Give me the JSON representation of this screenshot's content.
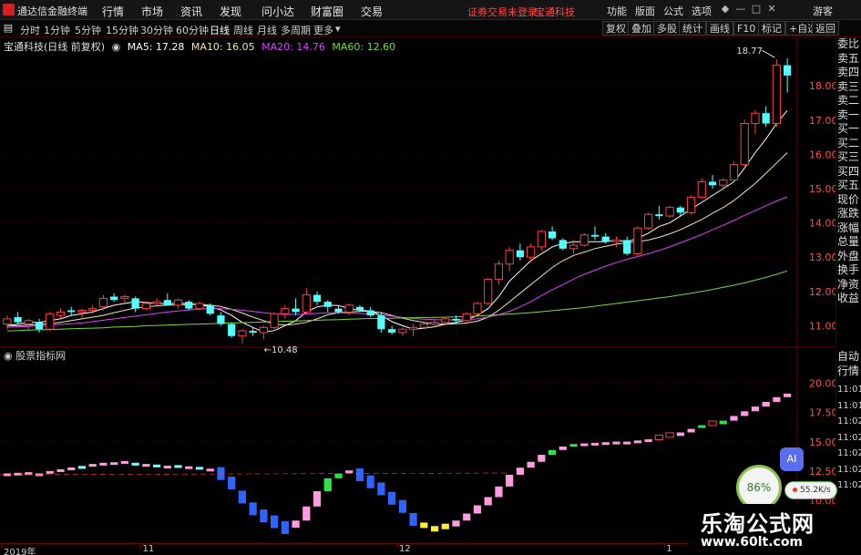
{
  "app": {
    "title": "通达信金融终端"
  },
  "menubar": {
    "items": [
      "行情",
      "市场",
      "资讯",
      "发现",
      "问小达",
      "财富圈",
      "交易"
    ],
    "notice": "证券交易未登录",
    "stock": "宝通科技",
    "right": [
      "功能",
      "版面",
      "公式",
      "选项"
    ],
    "user": "游客"
  },
  "periods": [
    "分时",
    "1分钟",
    "5分钟",
    "15分钟",
    "30分钟",
    "60分钟",
    "日线",
    "周线",
    "月线",
    "多周期",
    "更多"
  ],
  "active_period": "日线",
  "tools": [
    "复权",
    "叠加",
    "多股",
    "统计",
    "画线",
    "F10",
    "标记",
    "+自选",
    "返回"
  ],
  "stock_label": "宝通科技(日线 前复权)",
  "ma": [
    {
      "label": "MA5: 17.28",
      "color": "#ffffff"
    },
    {
      "label": "MA10: 16.05",
      "color": "#f3e5ab"
    },
    {
      "label": "MA20: 14.76",
      "color": "#e040fb"
    },
    {
      "label": "MA60: 12.60",
      "color": "#7cd942"
    }
  ],
  "indicator_label": "股票指标网",
  "order_items": [
    "委比",
    "卖五",
    "卖四",
    "卖三",
    "卖二",
    "卖一",
    "买一",
    "买二",
    "买三",
    "买四",
    "买五",
    "现价",
    "涨跌",
    "涨幅",
    "总量",
    "外盘",
    "换手",
    "净资",
    "收益"
  ],
  "order_items_2": [
    "自动",
    "行情"
  ],
  "time_ticks": [
    "11:01",
    "11:01",
    "11:02",
    "11:02",
    "11:02",
    "11:02",
    "11:02"
  ],
  "ai_button": "AI",
  "speed": {
    "ring": "86%",
    "rate": "55.2K/s"
  },
  "watermark": {
    "title": "乐淘公式网",
    "url": "www.60lt.com"
  },
  "colors": {
    "up": "#ff4040",
    "down": "#54ffff",
    "ma5": "#ffffff",
    "ma10": "#f3e5ab",
    "ma20": "#e040fb",
    "ma60": "#7cd942",
    "grid": "#3a0000"
  },
  "chart_data": [
    {
      "type": "candlestick",
      "series_name": "宝通科技",
      "x_labels": [
        "2019年",
        "11",
        "12",
        "1"
      ],
      "x_label_index": [
        0,
        13,
        37,
        62
      ],
      "ylim": [
        10.4,
        19.2
      ],
      "y_ticks": [
        11.0,
        12.0,
        13.0,
        14.0,
        15.0,
        16.0,
        17.0,
        18.0
      ],
      "annotations": [
        {
          "text": "18.77",
          "index": 72,
          "value": 18.77
        },
        {
          "text": "10.48",
          "index": 23,
          "value": 10.48
        }
      ],
      "ohlc": [
        [
          11.05,
          11.3,
          10.9,
          11.2
        ],
        [
          11.25,
          11.4,
          11.05,
          11.1
        ],
        [
          11.05,
          11.2,
          10.85,
          11.15
        ],
        [
          11.1,
          11.2,
          10.8,
          10.9
        ],
        [
          10.9,
          11.4,
          10.85,
          11.35
        ],
        [
          11.3,
          11.5,
          11.2,
          11.4
        ],
        [
          11.45,
          11.55,
          11.3,
          11.4
        ],
        [
          11.4,
          11.5,
          11.2,
          11.45
        ],
        [
          11.45,
          11.6,
          11.35,
          11.5
        ],
        [
          11.55,
          11.9,
          11.45,
          11.8
        ],
        [
          11.85,
          11.95,
          11.7,
          11.75
        ],
        [
          11.8,
          11.9,
          11.65,
          11.85
        ],
        [
          11.8,
          11.85,
          11.4,
          11.5
        ],
        [
          11.5,
          11.7,
          11.45,
          11.65
        ],
        [
          11.65,
          11.8,
          11.55,
          11.7
        ],
        [
          11.75,
          11.95,
          11.6,
          11.6
        ],
        [
          11.6,
          11.8,
          11.5,
          11.75
        ],
        [
          11.7,
          11.75,
          11.45,
          11.5
        ],
        [
          11.5,
          11.7,
          11.45,
          11.65
        ],
        [
          11.6,
          11.65,
          11.3,
          11.35
        ],
        [
          11.3,
          11.4,
          11.0,
          11.05
        ],
        [
          11.05,
          11.1,
          10.65,
          10.7
        ],
        [
          10.7,
          10.9,
          10.48,
          10.85
        ],
        [
          10.85,
          10.95,
          10.7,
          10.8
        ],
        [
          10.8,
          11.0,
          10.6,
          10.95
        ],
        [
          10.95,
          11.4,
          10.9,
          11.35
        ],
        [
          11.35,
          11.6,
          11.2,
          11.5
        ],
        [
          11.5,
          11.8,
          11.3,
          11.4
        ],
        [
          11.4,
          12.1,
          11.35,
          11.9
        ],
        [
          11.9,
          12.0,
          11.6,
          11.7
        ],
        [
          11.7,
          11.75,
          11.4,
          11.55
        ],
        [
          11.5,
          11.6,
          11.35,
          11.4
        ],
        [
          11.4,
          11.65,
          11.3,
          11.6
        ],
        [
          11.55,
          11.6,
          11.4,
          11.45
        ],
        [
          11.45,
          11.55,
          11.25,
          11.3
        ],
        [
          11.3,
          11.4,
          10.8,
          10.9
        ],
        [
          10.9,
          11.0,
          10.75,
          10.8
        ],
        [
          10.8,
          10.95,
          10.7,
          10.9
        ],
        [
          10.9,
          11.05,
          10.7,
          10.95
        ],
        [
          10.95,
          11.1,
          10.9,
          11.05
        ],
        [
          11.05,
          11.2,
          10.95,
          11.1
        ],
        [
          11.1,
          11.25,
          11.0,
          11.2
        ],
        [
          11.2,
          11.3,
          11.05,
          11.15
        ],
        [
          11.15,
          11.4,
          11.1,
          11.35
        ],
        [
          11.35,
          11.7,
          11.3,
          11.65
        ],
        [
          11.65,
          12.4,
          11.6,
          12.35
        ],
        [
          12.35,
          12.9,
          12.2,
          12.8
        ],
        [
          12.8,
          13.3,
          12.6,
          13.2
        ],
        [
          13.2,
          13.4,
          12.9,
          13.0
        ],
        [
          13.0,
          13.4,
          12.85,
          13.3
        ],
        [
          13.3,
          13.8,
          13.2,
          13.75
        ],
        [
          13.75,
          13.9,
          13.5,
          13.55
        ],
        [
          13.5,
          13.55,
          13.2,
          13.25
        ],
        [
          13.25,
          13.5,
          13.1,
          13.35
        ],
        [
          13.35,
          13.7,
          13.3,
          13.65
        ],
        [
          13.65,
          13.9,
          13.5,
          13.6
        ],
        [
          13.6,
          13.7,
          13.4,
          13.45
        ],
        [
          13.45,
          13.6,
          13.3,
          13.5
        ],
        [
          13.5,
          13.6,
          13.05,
          13.1
        ],
        [
          13.1,
          13.9,
          13.0,
          13.85
        ],
        [
          13.85,
          14.3,
          13.8,
          14.25
        ],
        [
          14.25,
          14.5,
          14.1,
          14.2
        ],
        [
          14.2,
          14.5,
          14.15,
          14.45
        ],
        [
          14.45,
          14.5,
          14.2,
          14.3
        ],
        [
          14.3,
          14.8,
          14.25,
          14.75
        ],
        [
          14.75,
          15.3,
          14.7,
          15.2
        ],
        [
          15.2,
          15.4,
          15.0,
          15.1
        ],
        [
          15.1,
          15.3,
          14.95,
          15.25
        ],
        [
          15.25,
          15.8,
          15.2,
          15.7
        ],
        [
          15.7,
          17.0,
          15.6,
          16.9
        ],
        [
          16.9,
          17.3,
          16.6,
          17.2
        ],
        [
          17.2,
          17.4,
          16.8,
          16.9
        ],
        [
          16.9,
          18.77,
          16.8,
          18.6
        ],
        [
          18.6,
          18.8,
          17.8,
          18.3
        ]
      ],
      "ma": {
        "MA5": [
          11.0,
          11.05,
          11.1,
          11.1,
          11.15,
          11.2,
          11.3,
          11.35,
          11.4,
          11.5,
          11.6,
          11.65,
          11.7,
          11.68,
          11.65,
          11.64,
          11.66,
          11.64,
          11.62,
          11.55,
          11.46,
          11.3,
          11.1,
          10.95,
          10.82,
          10.86,
          11.0,
          11.15,
          11.4,
          11.55,
          11.6,
          11.59,
          11.5,
          11.45,
          11.43,
          11.3,
          11.12,
          11.0,
          10.9,
          10.93,
          10.97,
          11.05,
          11.1,
          11.17,
          11.3,
          11.5,
          11.85,
          12.3,
          12.6,
          12.9,
          13.1,
          13.3,
          13.4,
          13.45,
          13.45,
          13.45,
          13.45,
          13.5,
          13.45,
          13.55,
          13.7,
          13.9,
          14.0,
          14.2,
          14.4,
          14.6,
          14.8,
          15.0,
          15.2,
          15.6,
          16.05,
          16.45,
          16.9,
          17.28
        ],
        "MA10": [
          11.0,
          11.0,
          11.02,
          11.04,
          11.06,
          11.1,
          11.15,
          11.2,
          11.25,
          11.3,
          11.38,
          11.45,
          11.52,
          11.55,
          11.58,
          11.6,
          11.61,
          11.62,
          11.62,
          11.6,
          11.56,
          11.48,
          11.37,
          11.25,
          11.15,
          11.05,
          11.02,
          11.05,
          11.1,
          11.2,
          11.32,
          11.38,
          11.4,
          11.42,
          11.42,
          11.38,
          11.3,
          11.22,
          11.15,
          11.1,
          11.05,
          11.05,
          11.06,
          11.08,
          11.13,
          11.25,
          11.45,
          11.7,
          11.95,
          12.2,
          12.45,
          12.7,
          12.9,
          13.05,
          13.15,
          13.25,
          13.32,
          13.38,
          13.42,
          13.45,
          13.5,
          13.58,
          13.68,
          13.8,
          13.95,
          14.1,
          14.28,
          14.45,
          14.65,
          14.9,
          15.15,
          15.45,
          15.75,
          16.05
        ],
        "MA20": [
          10.95,
          10.97,
          10.98,
          11.0,
          11.02,
          11.04,
          11.06,
          11.08,
          11.12,
          11.16,
          11.2,
          11.24,
          11.28,
          11.32,
          11.36,
          11.4,
          11.43,
          11.46,
          11.49,
          11.5,
          11.5,
          11.48,
          11.45,
          11.42,
          11.38,
          11.35,
          11.33,
          11.33,
          11.34,
          11.36,
          11.38,
          11.38,
          11.37,
          11.36,
          11.34,
          11.31,
          11.28,
          11.24,
          11.21,
          11.19,
          11.18,
          11.17,
          11.17,
          11.18,
          11.2,
          11.25,
          11.32,
          11.42,
          11.55,
          11.7,
          11.88,
          12.05,
          12.2,
          12.36,
          12.5,
          12.62,
          12.74,
          12.84,
          12.94,
          13.02,
          13.1,
          13.2,
          13.3,
          13.42,
          13.54,
          13.66,
          13.8,
          13.93,
          14.07,
          14.22,
          14.36,
          14.5,
          14.64,
          14.76
        ],
        "MA60": [
          10.85,
          10.86,
          10.87,
          10.88,
          10.89,
          10.9,
          10.91,
          10.92,
          10.93,
          10.94,
          10.96,
          10.97,
          10.98,
          11.0,
          11.01,
          11.02,
          11.03,
          11.04,
          11.05,
          11.06,
          11.07,
          11.08,
          11.09,
          11.1,
          11.11,
          11.12,
          11.13,
          11.14,
          11.15,
          11.16,
          11.17,
          11.18,
          11.19,
          11.2,
          11.21,
          11.22,
          11.22,
          11.23,
          11.23,
          11.24,
          11.24,
          11.25,
          11.26,
          11.27,
          11.28,
          11.3,
          11.32,
          11.34,
          11.36,
          11.38,
          11.41,
          11.44,
          11.47,
          11.5,
          11.53,
          11.57,
          11.61,
          11.65,
          11.69,
          11.73,
          11.77,
          11.81,
          11.85,
          11.9,
          11.95,
          12.0,
          12.06,
          12.12,
          12.18,
          12.25,
          12.33,
          12.41,
          12.5,
          12.6
        ]
      }
    },
    {
      "type": "indicator",
      "title": "股票指标网",
      "y_ticks": [
        10.0,
        12.5,
        15.0,
        17.5,
        20.0
      ],
      "ylim": [
        7.0,
        21.5
      ],
      "values": [
        12.2,
        12.25,
        12.3,
        12.2,
        12.4,
        12.55,
        12.7,
        12.95,
        13.0,
        13.1,
        13.15,
        13.25,
        13.1,
        13.0,
        12.95,
        12.85,
        12.9,
        12.8,
        12.75,
        12.6,
        12.3,
        11.5,
        10.3,
        9.3,
        8.7,
        8.2,
        7.7,
        8.3,
        9.5,
        10.8,
        11.9,
        12.3,
        12.45,
        12.2,
        11.6,
        11.0,
        10.2,
        9.5,
        8.4,
        7.9,
        7.6,
        7.8,
        8.3,
        8.9,
        9.6,
        10.3,
        11.2,
        12.2,
        12.8,
        13.3,
        13.9,
        14.3,
        14.6,
        14.7,
        14.75,
        14.8,
        14.85,
        14.9,
        14.9,
        15.0,
        15.1,
        15.3,
        15.5,
        15.8,
        16.1,
        16.3,
        16.5,
        16.8,
        17.2,
        17.6,
        18.0,
        18.4,
        18.8,
        19.1
      ],
      "colors": [
        "up",
        "up",
        "up",
        "up",
        "up",
        "up",
        "up",
        "down",
        "up",
        "up",
        "up",
        "up",
        "down",
        "up",
        "down",
        "up",
        "down",
        "up",
        "down",
        "up",
        "blue",
        "blue",
        "blue",
        "blue",
        "blue",
        "blue",
        "blue",
        "up",
        "up",
        "up",
        "green",
        "green",
        "up",
        "blue",
        "blue",
        "blue",
        "blue",
        "blue",
        "blue",
        "yellow",
        "yellow",
        "yellow",
        "up",
        "up",
        "up",
        "up",
        "up",
        "up",
        "up",
        "up",
        "up",
        "green",
        "up",
        "green",
        "up",
        "up",
        "up",
        "up",
        "up",
        "up",
        "up",
        "up",
        "up",
        "up",
        "up",
        "green",
        "up",
        "green",
        "up",
        "up",
        "up",
        "up",
        "up",
        "up"
      ]
    }
  ]
}
